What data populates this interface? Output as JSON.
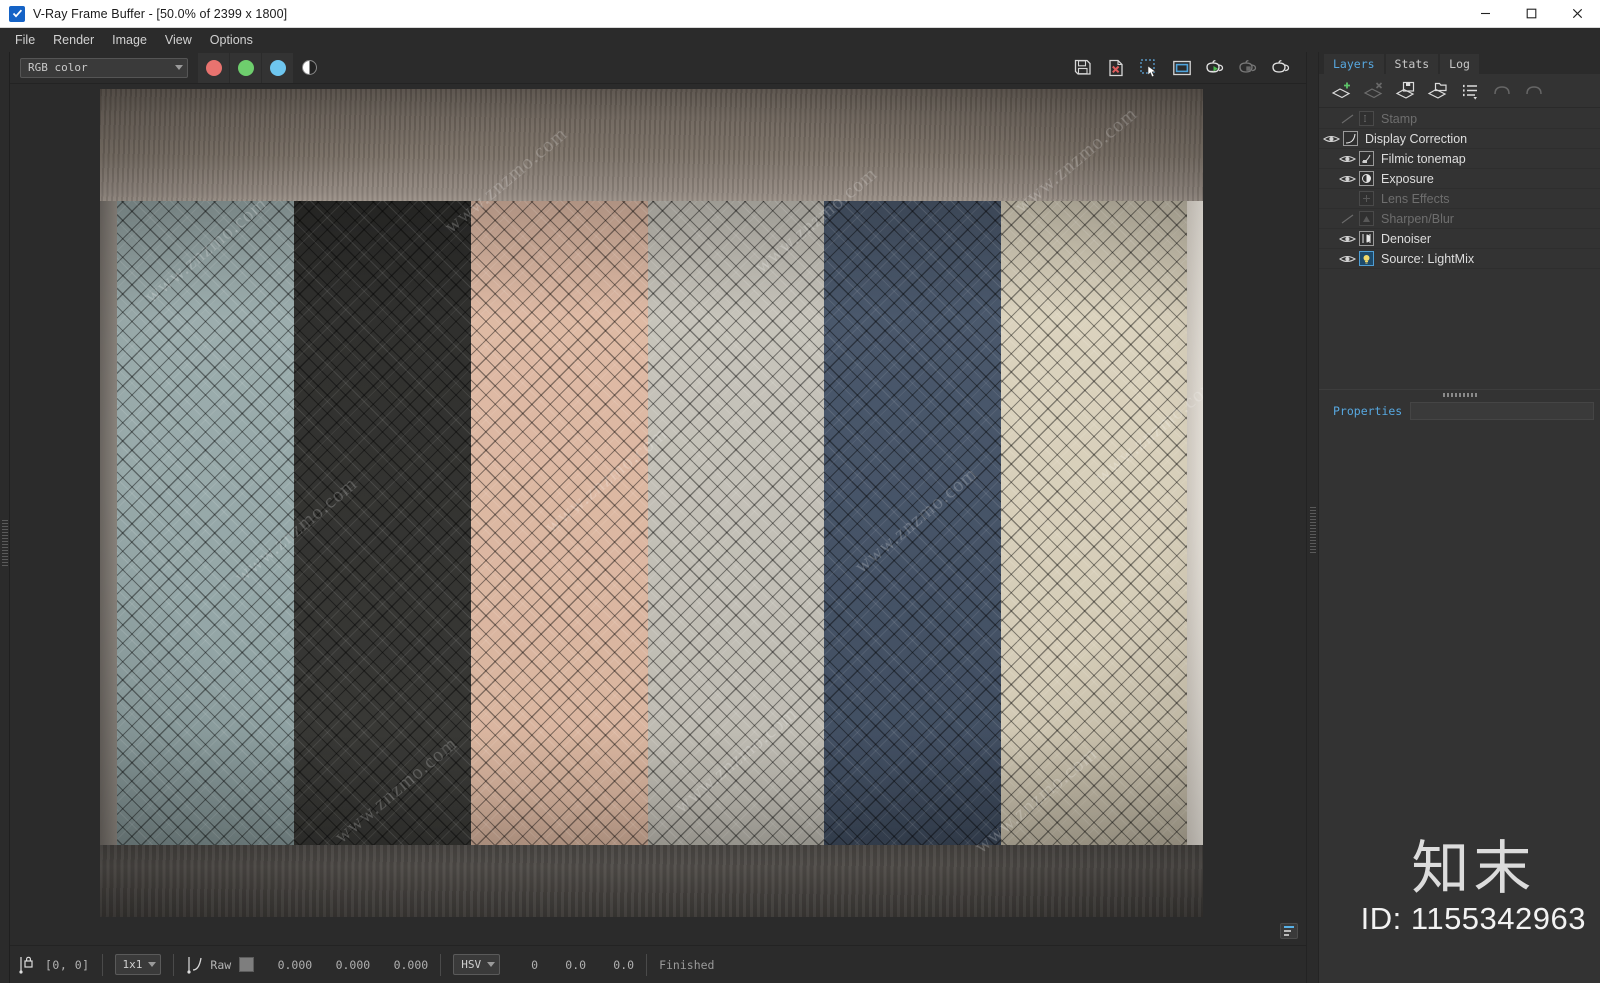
{
  "window": {
    "title": "V-Ray Frame Buffer - [50.0% of 2399 x 1800]",
    "logo_icon": "vray-checkbox-icon",
    "minimize_label": "—",
    "maximize_label": "□",
    "close_label": "✕"
  },
  "menu": {
    "items": [
      {
        "label": "File"
      },
      {
        "label": "Render"
      },
      {
        "label": "Image"
      },
      {
        "label": "View"
      },
      {
        "label": "Options"
      }
    ]
  },
  "toolbar": {
    "channel_select": {
      "value": "RGB color"
    },
    "channels": [
      {
        "name": "red-channel-button",
        "color": "#e8736f"
      },
      {
        "name": "green-channel-button",
        "color": "#6ece6d"
      },
      {
        "name": "blue-channel-button",
        "color": "#6ec6ef"
      }
    ],
    "alpha_button": {
      "name": "alpha-channel-button"
    },
    "right_buttons": [
      {
        "name": "save-image-button",
        "icon": "floppy-save-icon"
      },
      {
        "name": "clear-image-button",
        "icon": "file-with-x-icon"
      },
      {
        "name": "region-render-button",
        "icon": "marquee-select-icon"
      },
      {
        "name": "track-mouse-button",
        "icon": "framed-window-icon"
      },
      {
        "name": "start-render-button",
        "icon": "teapot-play-icon"
      },
      {
        "name": "stop-render-button",
        "icon": "teapot-stop-icon"
      },
      {
        "name": "render-last-button",
        "icon": "teapot-icon"
      }
    ]
  },
  "panel": {
    "tabs": [
      {
        "label": "Layers",
        "active": true
      },
      {
        "label": "Stats",
        "active": false
      },
      {
        "label": "Log",
        "active": false
      }
    ],
    "layer_toolbar": [
      {
        "name": "add-layer-button",
        "icon": "layer-plus-icon",
        "enabled": true
      },
      {
        "name": "remove-layer-button",
        "icon": "layer-minus-icon",
        "enabled": false
      },
      {
        "name": "save-layers-button",
        "icon": "layer-save-icon",
        "enabled": true
      },
      {
        "name": "load-layers-button",
        "icon": "layer-open-icon",
        "enabled": true
      },
      {
        "name": "layer-presets-button",
        "icon": "list-menu-icon",
        "enabled": true
      },
      {
        "name": "undo-button",
        "icon": "undo-arrow-icon",
        "enabled": false
      },
      {
        "name": "redo-button",
        "icon": "redo-arrow-icon",
        "enabled": false
      }
    ],
    "layers": [
      {
        "label": "Stamp",
        "icon": "stamp-icon",
        "visible": false,
        "enabled": false,
        "indent": 2
      },
      {
        "label": "Display Correction",
        "icon": "curve-icon",
        "visible": true,
        "enabled": true,
        "indent": 1
      },
      {
        "label": "Filmic tonemap",
        "icon": "filmic-icon",
        "visible": true,
        "enabled": true,
        "indent": 2
      },
      {
        "label": "Exposure",
        "icon": "exposure-icon",
        "visible": true,
        "enabled": true,
        "indent": 2
      },
      {
        "label": "Lens Effects",
        "icon": "lens-plus-icon",
        "visible": false,
        "enabled": false,
        "indent": 2
      },
      {
        "label": "Sharpen/Blur",
        "icon": "sharpen-icon",
        "visible": false,
        "enabled": false,
        "indent": 2
      },
      {
        "label": "Denoiser",
        "icon": "denoiser-icon",
        "visible": true,
        "enabled": true,
        "indent": 2
      },
      {
        "label": "Source: LightMix",
        "icon": "lightmix-icon",
        "visible": true,
        "enabled": true,
        "indent": 2
      }
    ],
    "properties_tab": "Properties"
  },
  "statusbar": {
    "pixel_lock_icon": "pixel-lock-icon",
    "coordinates": "[0,  0]",
    "zoom_select": "1x1",
    "curve_icon": "corner-curve-icon",
    "raw_label": "Raw",
    "raw_swatch": "#7e7e7e",
    "rgb_values": [
      "0.000",
      "0.000",
      "0.000"
    ],
    "mode_select": "HSV",
    "hsv_values": [
      "0",
      "0.0",
      "0.0"
    ],
    "status_text": "Finished"
  },
  "viewport": {
    "corner_button": "image-info-toggle",
    "diagonal_watermark": "www.znzmo.com",
    "strips": [
      {
        "name": "sage-gray-herringbone",
        "color_top": "#9fb0b0",
        "color_bot": "#8ea1a2"
      },
      {
        "name": "charcoal-herringbone",
        "color_top": "#2e2e2c",
        "color_bot": "#3a3a37"
      },
      {
        "name": "peach-herringbone",
        "color_top": "#e0bba6",
        "color_bot": "#d8b49e"
      },
      {
        "name": "warm-gray-herringbone",
        "color_top": "#c9c6bd",
        "color_bot": "#bdbab1"
      },
      {
        "name": "navy-herringbone",
        "color_top": "#4c5a6e",
        "color_bot": "#404d60"
      },
      {
        "name": "cream-herringbone",
        "color_top": "#ddd5c0",
        "color_bot": "#d2c9b4"
      }
    ]
  },
  "watermark": {
    "logo_text": "知末",
    "id_text": "ID: 1155342963"
  }
}
